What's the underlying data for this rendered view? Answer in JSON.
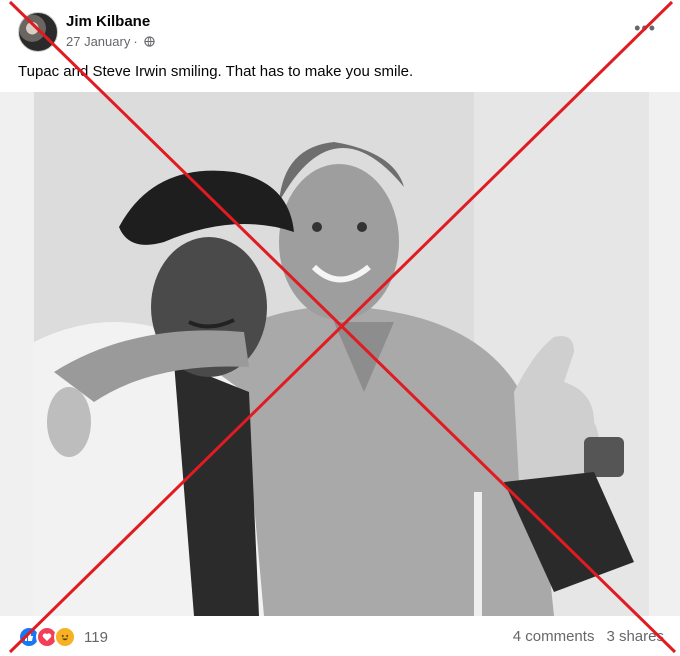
{
  "post": {
    "author": "Jim Kilbane",
    "date": "27 January",
    "separator": "·",
    "privacy_icon": "globe-icon",
    "more_icon": "more-options-icon",
    "caption": "Tupac and Steve Irwin smiling. That has to make you smile."
  },
  "reactions": {
    "icons": [
      "like-icon",
      "love-icon",
      "haha-icon"
    ],
    "count": "119"
  },
  "stats": {
    "comments": "4 comments",
    "shares": "3 shares"
  },
  "overlay": {
    "type": "red-cross",
    "color": "#e01b22"
  },
  "colors": {
    "like": "#1877f2",
    "love": "#f33e58",
    "haha": "#f7b125",
    "secondary_text": "#65676b"
  }
}
